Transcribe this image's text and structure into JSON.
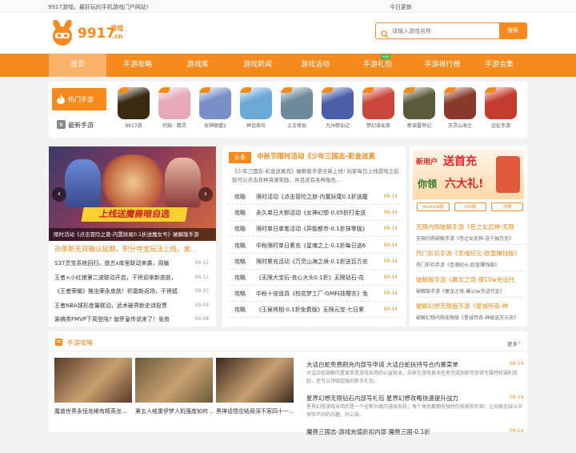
{
  "topbar": {
    "tagline": "9917游戏，最好玩的手机游戏门户网站!",
    "today": "今日更新"
  },
  "header": {
    "logo_text": "9917",
    "logo_suffix": "游戏",
    "logo_domain": ".cn",
    "search_placeholder": "请输入游戏名称",
    "search_button": "搜索"
  },
  "nav": {
    "items": [
      "首页",
      "手游攻略",
      "游戏库",
      "游戏新闻",
      "游戏活动",
      "手游礼包",
      "手游排行榜",
      "手游合集"
    ],
    "badge": "new"
  },
  "hot": {
    "tab_hot": "热门手游",
    "tab_new": "最新手游",
    "games": [
      {
        "name": "9917游",
        "color": "#3b2a12"
      },
      {
        "name": "灼焰 · 精灵",
        "color": "#e6a9b8"
      },
      {
        "name": "女神联盟2",
        "color": "#7a8fc8"
      },
      {
        "name": "神话奇兵",
        "color": "#6aa8d8"
      },
      {
        "name": "上古修仙",
        "color": "#6f8a9c"
      },
      {
        "name": "九州修仙记",
        "color": "#4b5fa8"
      },
      {
        "name": "梦幻诛仙变",
        "color": "#c8463a"
      },
      {
        "name": "新诺雷帝记",
        "color": "#5a5a3c"
      },
      {
        "name": "万灵山海之",
        "color": "#8a3a2a"
      },
      {
        "name": "远征手游",
        "color": "#c43a2e"
      }
    ]
  },
  "banner": {
    "overlay": "上线送魔兽暗自选",
    "caption": "限时活动《点击冒险之旅-内置妖尾0.1折送魔女号》破解版手游",
    "promo_title": "孙策新无双确认延期，积分夺宝玩法上线，美..."
  },
  "left_news": [
    {
      "title": "S37灵宝系统回归，盘古x库里联动来袭，周输",
      "date": "09-12"
    },
    {
      "title": "王者×小红娘第二波联动开启，干将迎来新皮肤，",
      "date": "09-11"
    },
    {
      "title": "《王者荣耀》推出荣永皮肤！织霜新返场，干将狐",
      "date": "09-10"
    },
    {
      "title": "王者NBA球形度量联动，武术破界新史诗投票",
      "date": "09-09"
    },
    {
      "title": "装搞类FMVP下周登陆? 伽罗皇传说来了！张良",
      "date": "09-08"
    }
  ],
  "headline": {
    "tag": "头条",
    "title": "中秋节限时活动《少年三国志-彩金送真",
    "summary": "《少年三国志-彩金送真充》破解版手游全新上线! 玩家每日上线游戏之后就可以点击各种资源奖励，并且还有各种角色..."
  },
  "center_news": [
    {
      "tag": "攻略",
      "title": "限时活动《点击冒险之旅-内置妖尾0.1折送魔",
      "date": "09-14"
    },
    {
      "tag": "攻略",
      "title": "永久单日大额活动《女神幻想-0.05折打金送",
      "date": "09-14"
    },
    {
      "tag": "攻略",
      "title": "限时单日单笔活动《异能都市-0.1折抹零版》",
      "date": "09-14"
    },
    {
      "tag": "攻略",
      "title": "中秋限时单日累充《星魂之上-0.1折每日送6",
      "date": "09-14"
    },
    {
      "tag": "攻略",
      "title": "限时累充活动《万灵山海之境-0.1折送百万充",
      "date": "09-14"
    },
    {
      "tag": "攻略",
      "title": "《无限大宝石-良心大头0.1折》无限钻石-花",
      "date": "09-14"
    },
    {
      "tag": "攻略",
      "title": "中秋十倍道具《校花梦工厂-GM科技樱衣》免费",
      "date": "09-14"
    },
    {
      "tag": "攻略",
      "title": "《王侯将相-0.1折免费版》无限元宝-七日累",
      "date": "09-14"
    }
  ],
  "right": {
    "ad_line1": "新用户",
    "ad_line2": "送首充",
    "ad_line3": "你领",
    "ad_line4": "六大礼!",
    "btn_android": "Android版",
    "btn_ios": "iOS版",
    "btn_detail": "详情",
    "links": [
      {
        "title": "无限内购破解手游《苍之女武神-无限",
        "sub": "无限内购破解手游《苍之女武神-送千抽万充》"
      },
      {
        "title": "热门折扣手游《圣魂纪元-欧皇赚钱版》",
        "sub": "热门折扣手游《圣魂纪元-欧皇赚钱版》"
      },
      {
        "title": "破解版手游《屠龙之境-爆10w充送代",
        "sub": "破解版手游《屠龙之境-爆10w充送代金》"
      },
      {
        "title": "破解幻想无限版手游《星城传奇-神",
        "sub": "破解幻想内购无限版《星城传奇-神级送万元充》"
      }
    ]
  },
  "guides": {
    "title": "手游攻略",
    "more": "更多",
    "thumbs": [
      {
        "caption": "魔兽世界永恒岛稀有精英坐...",
        "color": "#5a3a2a"
      },
      {
        "caption": "第五人格重伊梦人机强度如何 ...",
        "color": "#6a5a3a"
      },
      {
        "caption": "黑神话悟空结局深不客四十一...",
        "color": "#3a2a1e"
      }
    ],
    "items": [
      {
        "title": "大话白蛇免费刷充内部号申请 大话白蛇扶持号合内置菜单",
        "summary": "大话白蛇破解内置菜单是游戏采用的公益版本，玩家在游戏首充任务完成后即可获得专属特权福利奖励，还可以领取超值的新手礼包。",
        "date": "09-14"
      },
      {
        "title": "星界幻想无限钻石内部号礼包 星界幻想攻略快速提升战力",
        "summary": "星界幻想游戏采用的是一个全新升级的游戏系统，每个角色都拥有独特的技能和外观，让玩家在战斗中体验不同的乐趣，同上线。",
        "date": "09-14"
      },
      {
        "title": "魔兽三国志-游戏充值折扣内部 魔兽三国-0.1折",
        "summary": "",
        "date": "09-14"
      }
    ]
  }
}
